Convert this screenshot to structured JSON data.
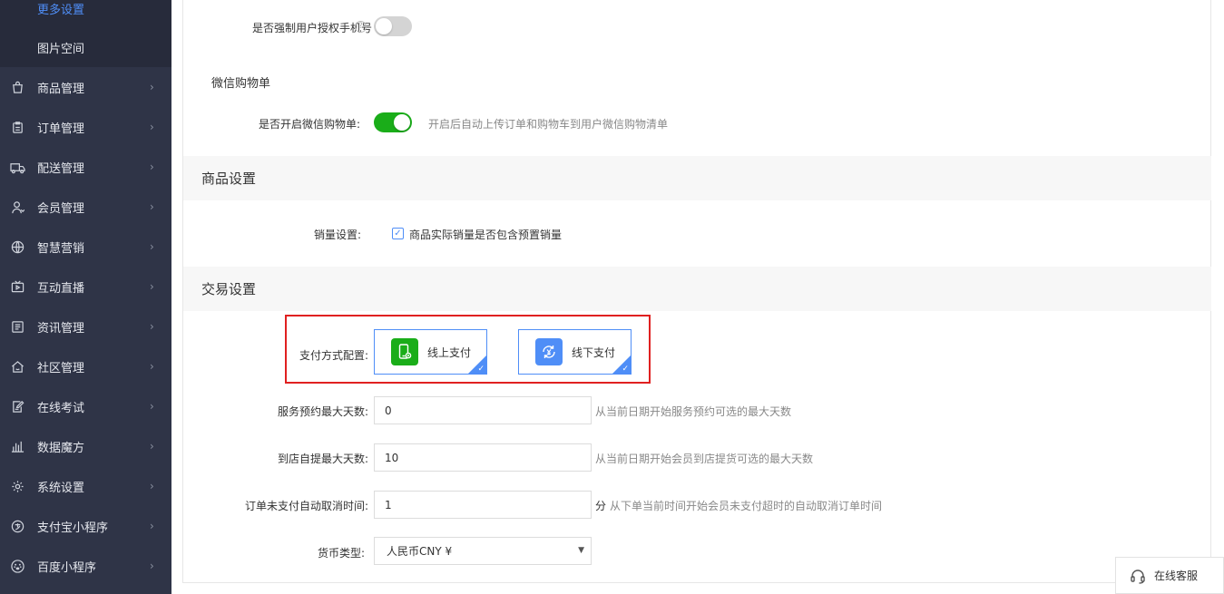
{
  "sidebar": {
    "sub_items": [
      {
        "label": "更多设置",
        "active": true
      },
      {
        "label": "图片空间",
        "active": false
      }
    ],
    "items": [
      {
        "label": "商品管理",
        "icon": "shopping-bag-icon"
      },
      {
        "label": "订单管理",
        "icon": "clipboard-icon"
      },
      {
        "label": "配送管理",
        "icon": "truck-icon"
      },
      {
        "label": "会员管理",
        "icon": "user-icon"
      },
      {
        "label": "智慧营销",
        "icon": "globe-icon"
      },
      {
        "label": "互动直播",
        "icon": "tv-icon"
      },
      {
        "label": "资讯管理",
        "icon": "news-icon"
      },
      {
        "label": "社区管理",
        "icon": "home-icon"
      },
      {
        "label": "在线考试",
        "icon": "edit-doc-icon"
      },
      {
        "label": "数据魔方",
        "icon": "chart-bars-icon"
      },
      {
        "label": "系统设置",
        "icon": "gear-icon"
      },
      {
        "label": "支付宝小程序",
        "icon": "alipay-icon"
      },
      {
        "label": "百度小程序",
        "icon": "baidu-paw-icon"
      }
    ]
  },
  "main": {
    "force_phone": {
      "label": "是否强制用户授权手机号",
      "enabled": false
    },
    "wechat_cart_title": "微信购物单",
    "wechat_cart": {
      "label": "是否开启微信购物单:",
      "enabled": true,
      "hint": "开启后自动上传订单和购物车到用户微信购物清单"
    },
    "goods_section": {
      "title": "商品设置",
      "sales_label": "销量设置:",
      "sales_checkbox_label": "商品实际销量是否包含预置销量",
      "sales_checked": true
    },
    "trade_section": {
      "title": "交易设置",
      "pay_method_label": "支付方式配置:",
      "pay_methods": [
        {
          "label": "线上支付",
          "icon": "phone-pay-icon",
          "color": "#1aad19",
          "selected": true
        },
        {
          "label": "线下支付",
          "icon": "cash-yen-icon",
          "color": "#4f8ef7",
          "selected": true
        }
      ],
      "service_days": {
        "label": "服务预约最大天数:",
        "value": "0",
        "hint": "从当前日期开始服务预约可选的最大天数"
      },
      "pickup_days": {
        "label": "到店自提最大天数:",
        "value": "10",
        "hint": "从当前日期开始会员到店提货可选的最大天数"
      },
      "auto_cancel": {
        "label": "订单未支付自动取消时间:",
        "value": "1",
        "unit": "分",
        "hint": "从下单当前时间开始会员未支付超时的自动取消订单时间"
      },
      "currency": {
        "label": "货币类型:",
        "value": "人民币CNY ¥"
      }
    }
  },
  "service": {
    "label": "在线客服"
  },
  "colors": {
    "accent": "#4f8ef7",
    "switch_on": "#1aad19",
    "highlight": "#e02020",
    "sidebar_bg": "#2f3447"
  }
}
